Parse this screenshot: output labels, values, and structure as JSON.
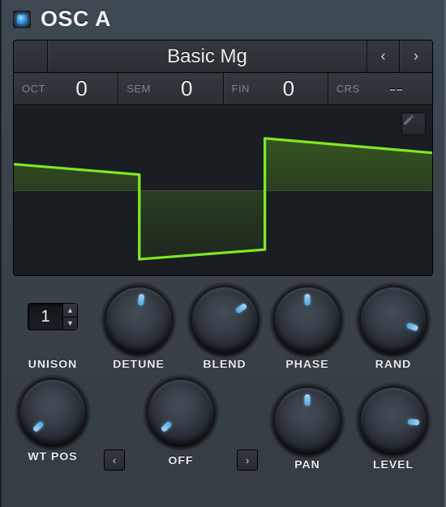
{
  "header": {
    "title": "OSC A"
  },
  "preset": {
    "name": "Basic Mg",
    "prev_icon": "‹",
    "next_icon": "›"
  },
  "tune": {
    "oct": {
      "label": "OCT",
      "value": "0"
    },
    "sem": {
      "label": "SEM",
      "value": "0"
    },
    "fin": {
      "label": "FIN",
      "value": "0"
    },
    "crs": {
      "label": "CRS",
      "value": "--"
    }
  },
  "unison": {
    "label": "UNISON",
    "value": "1"
  },
  "knobs": {
    "detune": {
      "label": "DETUNE",
      "angle": 7
    },
    "blend": {
      "label": "BLEND",
      "angle": 55
    },
    "phase": {
      "label": "PHASE",
      "angle": 0
    },
    "rand": {
      "label": "RAND",
      "angle": 110
    },
    "wtpos": {
      "label": "WT POS",
      "angle": -135
    },
    "warp": {
      "label": "OFF",
      "angle": -135
    },
    "pan": {
      "label": "PAN",
      "angle": 0
    },
    "level": {
      "label": "LEVEL",
      "angle": 95
    }
  },
  "icons": {
    "prev": "‹",
    "next": "›",
    "up": "▲",
    "down": "▼"
  }
}
